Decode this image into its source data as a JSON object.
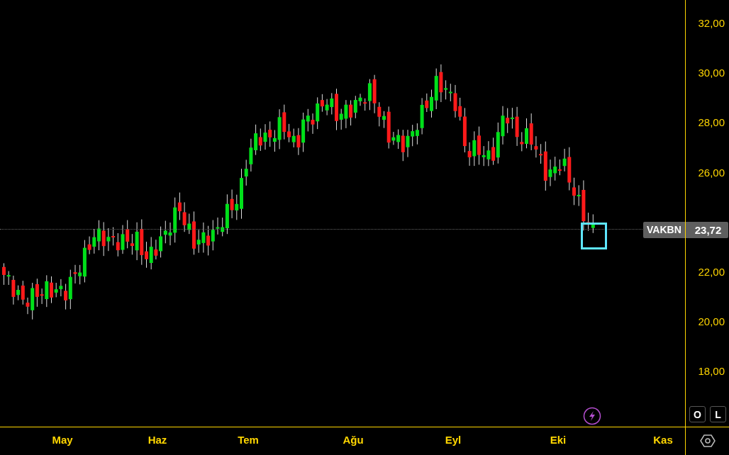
{
  "chart": {
    "symbol": "VAKBN",
    "last_price": "23,72",
    "y_axis_upper": [
      "32,00",
      "30,00",
      "28,00",
      "26,00"
    ],
    "y_axis_lower": [
      "22,00",
      "20,00",
      "18,00"
    ],
    "x_axis": [
      "May",
      "Haz",
      "Tem",
      "Ağu",
      "Eyl",
      "Eki",
      "Kas"
    ],
    "scale_buttons": [
      {
        "label": "O"
      },
      {
        "label": "L"
      }
    ]
  }
}
